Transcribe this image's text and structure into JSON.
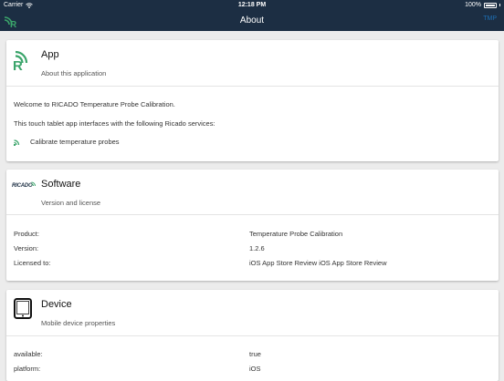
{
  "status_bar": {
    "carrier": "Carrier",
    "time": "12:18 PM",
    "battery": "100%"
  },
  "nav": {
    "title": "About",
    "right_label": "TMP"
  },
  "colors": {
    "header_bg": "#1c2e43",
    "brand_green": "#3aa46a",
    "background": "#ececec"
  },
  "app_card": {
    "icon": "ricado-signal-icon",
    "title": "App",
    "subtitle": "About this application",
    "welcome": "Welcome to RICADO Temperature Probe Calibration.",
    "services_intro": "This touch tablet app interfaces with the following Ricado services:",
    "services": [
      {
        "icon": "signal-icon",
        "label": "Calibrate temperature probes"
      }
    ]
  },
  "software_card": {
    "icon": "ricado-logo-icon",
    "logo_text": "RICADO",
    "title": "Software",
    "subtitle": "Version and license",
    "rows": [
      {
        "label": "Product:",
        "value": "Temperature Probe Calibration"
      },
      {
        "label": "Version:",
        "value": "1.2.6"
      },
      {
        "label": "Licensed to:",
        "value": "iOS App Store Review iOS App Store Review"
      }
    ]
  },
  "device_card": {
    "icon": "tablet-icon",
    "title": "Device",
    "subtitle": "Mobile device properties",
    "rows": [
      {
        "label": "available:",
        "value": "true"
      },
      {
        "label": "platform:",
        "value": "iOS"
      }
    ]
  }
}
